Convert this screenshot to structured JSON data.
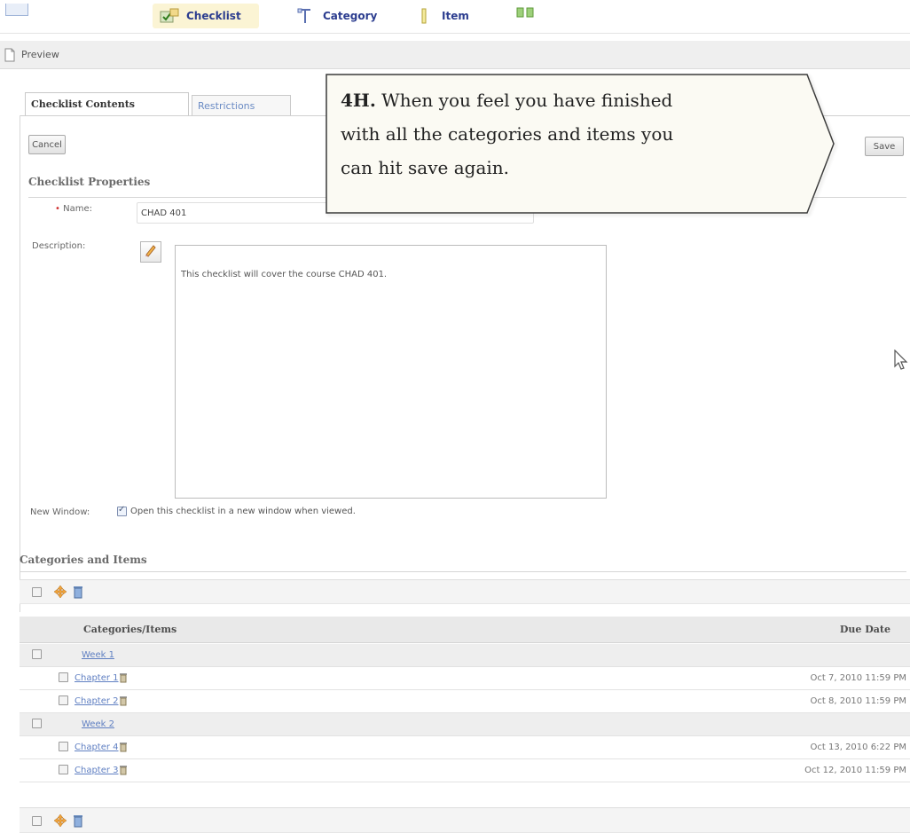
{
  "toolbar": {
    "checklist_label": "Checklist",
    "category_label": "Category",
    "item_label": "Item"
  },
  "preview_label": "Preview",
  "tabs": {
    "contents_label": "Checklist Contents",
    "restrictions_label": "Restrictions"
  },
  "buttons": {
    "cancel_label": "Cancel",
    "save_label": "Save"
  },
  "properties": {
    "section_title": "Checklist Properties",
    "name_required_marker": "•",
    "name_label": "Name:",
    "name_value": "CHAD 401",
    "description_label": "Description:",
    "description_value": "This checklist will cover the course CHAD 401.",
    "new_window_label": "New Window:",
    "new_window_checked": true,
    "new_window_text": "Open this checklist in a new window when viewed."
  },
  "categories": {
    "section_title": "Categories and Items",
    "col_name": "Categories/Items",
    "col_due": "Due Date",
    "rows": [
      {
        "type": "category",
        "name": "Week 1",
        "due": ""
      },
      {
        "type": "item",
        "name": "Chapter 1",
        "due": "Oct 7, 2010 11:59 PM"
      },
      {
        "type": "item",
        "name": "Chapter 2",
        "due": "Oct 8, 2010 11:59 PM"
      },
      {
        "type": "category",
        "name": "Week 2",
        "due": ""
      },
      {
        "type": "item",
        "name": "Chapter 4",
        "due": "Oct 13, 2010 6:22 PM"
      },
      {
        "type": "item",
        "name": "Chapter 3",
        "due": "Oct 12, 2010 11:59 PM"
      }
    ]
  },
  "callout": {
    "step": "4H.",
    "line1": "When you feel you have finished",
    "line2": "with all the categories and items you",
    "line3": "can hit save again."
  },
  "colors": {
    "link": "#5f7fc2",
    "toolbar_text": "#2c3d8f",
    "callout_fill": "#fbfaf3"
  },
  "icons": {
    "checklist": "checklist-icon",
    "category": "category-icon",
    "item": "item-icon",
    "preview": "preview-icon",
    "edit": "pencil-icon",
    "move": "move-icon",
    "delete": "trash-icon",
    "pointer": "mouse-pointer-icon"
  }
}
